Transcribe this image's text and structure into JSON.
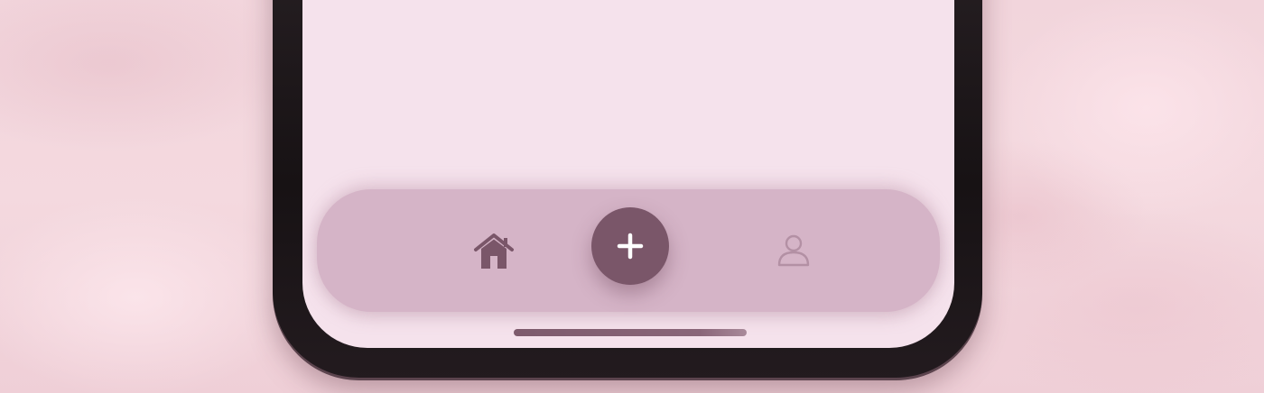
{
  "colors": {
    "screen_background": "#f5e2ec",
    "nav_bar": "#d5b4c7",
    "accent": "#7a5669",
    "icon_active": "#7a5669",
    "icon_inactive": "#b390a4",
    "frame": "#171214"
  },
  "bottom_nav": {
    "items": [
      {
        "icon": "home-icon",
        "active": true
      },
      {
        "icon": "plus-icon",
        "primary": true
      },
      {
        "icon": "user-icon",
        "active": false
      }
    ]
  }
}
